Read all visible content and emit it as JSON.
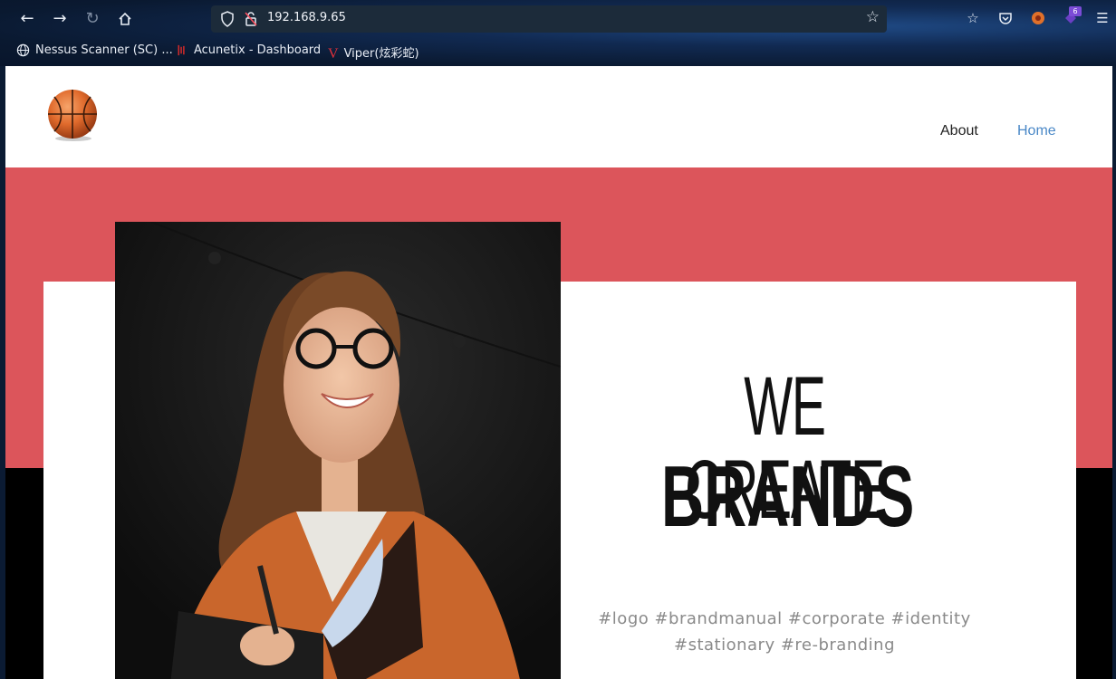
{
  "browser": {
    "url": "192.168.9.65",
    "extension_badge": "6",
    "bookmarks": [
      {
        "label": "Nessus Scanner (SC) ...",
        "icon": "globe-icon"
      },
      {
        "label": "Acunetix - Dashboard",
        "icon": "acunetix-icon"
      },
      {
        "label": "Viper(炫彩蛇)",
        "icon": "viper-icon"
      }
    ]
  },
  "site": {
    "nav": {
      "about": "About",
      "home": "Home"
    },
    "hero": {
      "line1": "WE CREATE",
      "line2": "BRANDS",
      "tags_line1": "#logo #brandmanual #corporate #identity",
      "tags_line2": "#stationary #re-branding"
    },
    "colors": {
      "accent_red": "#dc555b",
      "nav_active": "#4a88c7"
    }
  }
}
